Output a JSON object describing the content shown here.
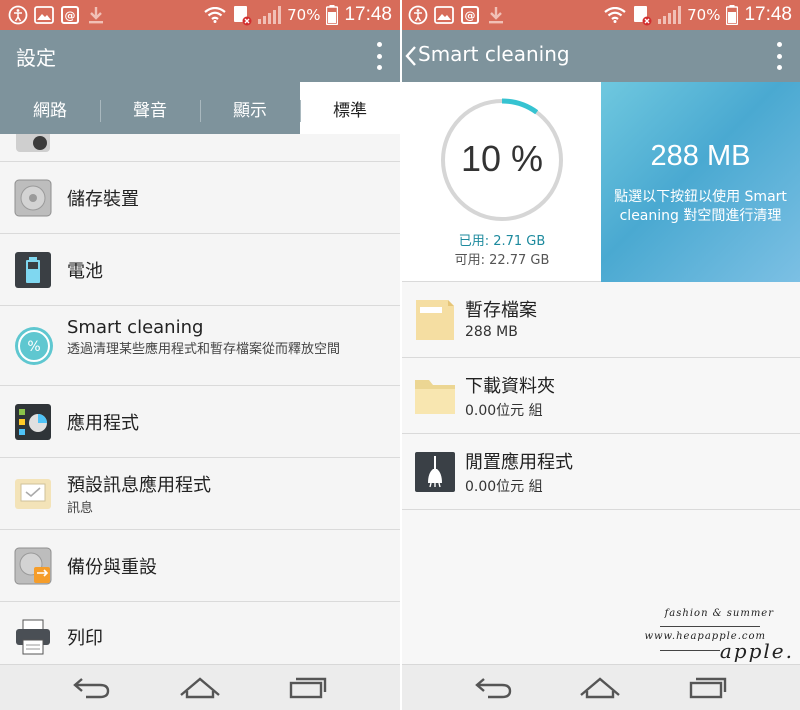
{
  "status_bar": {
    "battery": "70%",
    "time": "17:48"
  },
  "settings_screen": {
    "title": "設定",
    "tabs": [
      "網路",
      "聲音",
      "顯示",
      "標準"
    ],
    "active_tab": "標準",
    "items": [
      {
        "title": "儲存裝置",
        "subtitle": ""
      },
      {
        "title": "電池",
        "subtitle": ""
      },
      {
        "title": "Smart cleaning",
        "subtitle": "透過清理某些應用程式和暫存檔案從而釋放空間"
      },
      {
        "title": "應用程式",
        "subtitle": ""
      },
      {
        "title": "預設訊息應用程式",
        "subtitle": "訊息"
      },
      {
        "title": "備份與重設",
        "subtitle": ""
      },
      {
        "title": "列印",
        "subtitle": ""
      }
    ]
  },
  "smart_cleaning_screen": {
    "title": "Smart cleaning",
    "usage_percent_label": "10 %",
    "usage_fraction": 0.1,
    "used_label": "已用: 2.71 GB",
    "available_label": "可用: 22.77 GB",
    "cleanable_size": "288 MB",
    "cleanable_desc": "點選以下按鈕以使用 Smart cleaning 對空間進行清理",
    "items": [
      {
        "title": "暫存檔案",
        "value": "288 MB"
      },
      {
        "title": "下載資料夾",
        "value": "0.00位元 組"
      },
      {
        "title": "閒置應用程式",
        "value": "0.00位元 組"
      }
    ]
  },
  "watermark": {
    "line1": "fashion & summer",
    "line2": "www.heapapple.com",
    "line3": "apple."
  },
  "colors": {
    "status_bar": "#d76c5a",
    "app_bar": "#7e939c",
    "gauge_accent": "#36c3d1",
    "clean_card": "#4aa9d1"
  }
}
